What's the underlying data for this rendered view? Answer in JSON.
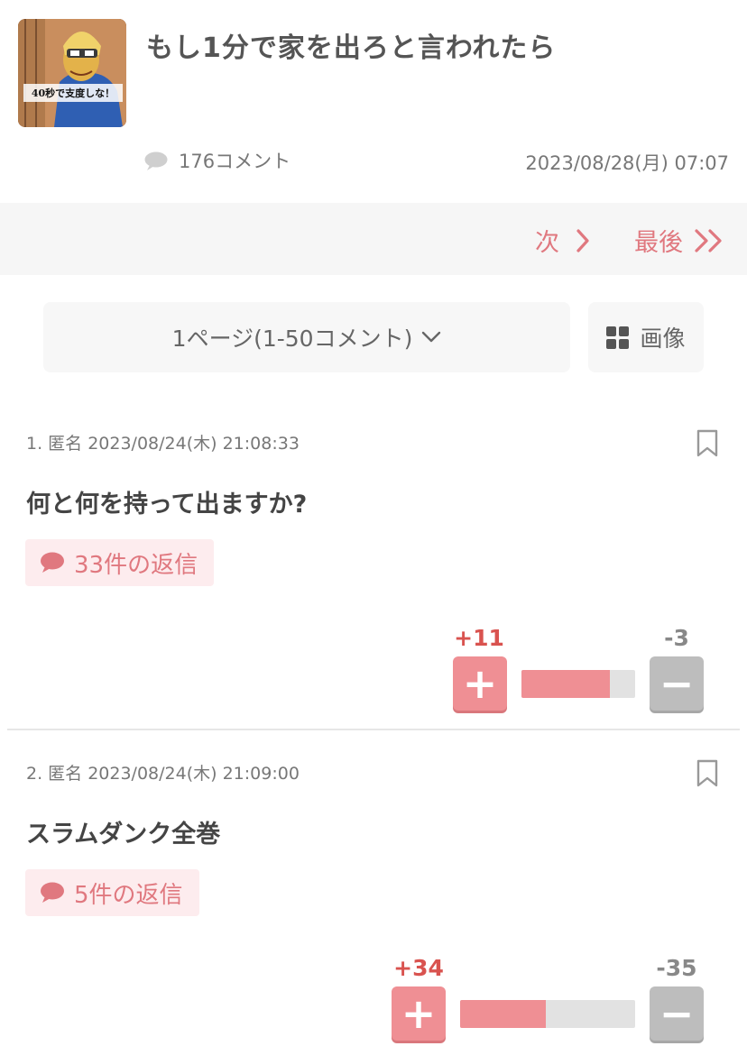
{
  "topic": {
    "title": "もし1分で家を出ろと言われたら",
    "thumbnail_caption": "40秒で支度しな！",
    "comment_count": "176コメント",
    "posted": "2023/08/28(月) 07:07"
  },
  "pager": {
    "next_label": "次",
    "last_label": "最後"
  },
  "page_select": {
    "label": "1ページ(1-50コメント)"
  },
  "image_button": {
    "label": "画像"
  },
  "colors": {
    "accent": "#e0787f",
    "plus": "#ef8f94",
    "minus": "#bdbdbd"
  },
  "comments": [
    {
      "meta": "1. 匿名 2023/08/24(木) 21:08:33",
      "body": "何と何を持って出ますか?",
      "replies": "33件の返信",
      "plus": "+11",
      "minus": "-3",
      "plus_button": "+",
      "minus_button": "−",
      "plus_ratio": 0.78
    },
    {
      "meta": "2. 匿名 2023/08/24(木) 21:09:00",
      "body": "スラムダンク全巻",
      "replies": "5件の返信",
      "plus": "+34",
      "minus": "-35",
      "plus_button": "+",
      "minus_button": "−",
      "plus_ratio": 0.49
    }
  ]
}
